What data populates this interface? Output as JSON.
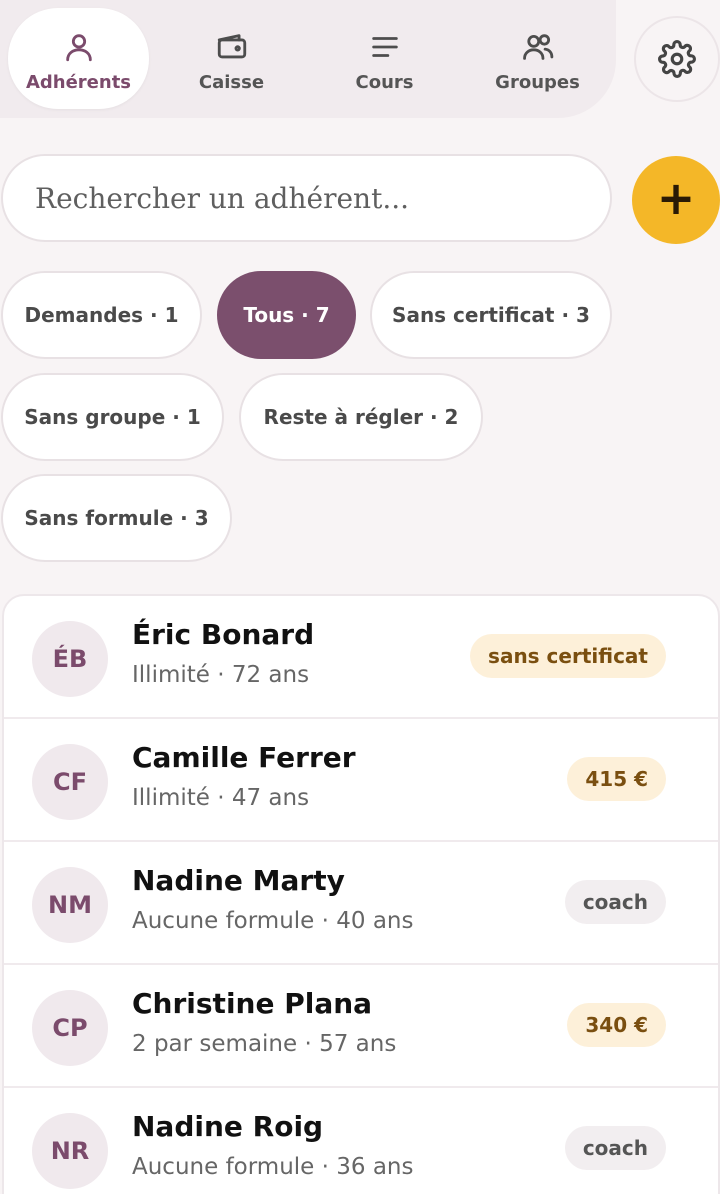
{
  "nav": {
    "items": [
      {
        "label": "Adhérents",
        "icon": "user-icon",
        "active": true
      },
      {
        "label": "Caisse",
        "icon": "wallet-icon",
        "active": false
      },
      {
        "label": "Cours",
        "icon": "list-icon",
        "active": false
      },
      {
        "label": "Groupes",
        "icon": "users-icon",
        "active": false
      }
    ],
    "settings_icon": "gear-icon"
  },
  "search": {
    "placeholder": "Rechercher un adhérent...",
    "add_label": "+"
  },
  "filters": [
    {
      "label": "Demandes · 1",
      "active": false
    },
    {
      "label": "Tous · 7",
      "active": true
    },
    {
      "label": "Sans certificat · 3",
      "active": false
    },
    {
      "label": "Sans groupe · 1",
      "active": false
    },
    {
      "label": "Reste à régler · 2",
      "active": false
    },
    {
      "label": "Sans formule · 3",
      "active": false
    }
  ],
  "members": [
    {
      "initials": "ÉB",
      "name": "Éric Bonard",
      "details": "Illimité · 72 ans",
      "badge": "sans certificat",
      "badge_type": "warn"
    },
    {
      "initials": "CF",
      "name": "Camille Ferrer",
      "details": "Illimité · 47 ans",
      "badge": "415 €",
      "badge_type": "warn"
    },
    {
      "initials": "NM",
      "name": "Nadine Marty",
      "details": "Aucune formule · 40 ans",
      "badge": "coach",
      "badge_type": "neutral"
    },
    {
      "initials": "CP",
      "name": "Christine Plana",
      "details": "2 par semaine · 57 ans",
      "badge": "340 €",
      "badge_type": "warn"
    },
    {
      "initials": "NR",
      "name": "Nadine Roig",
      "details": "Aucune formule · 36 ans",
      "badge": "coach",
      "badge_type": "neutral"
    }
  ],
  "colors": {
    "accent": "#7b4f6d",
    "add_button": "#f4b728",
    "warn_badge_bg": "#fdf0d9",
    "neutral_badge_bg": "#f2eef0"
  }
}
